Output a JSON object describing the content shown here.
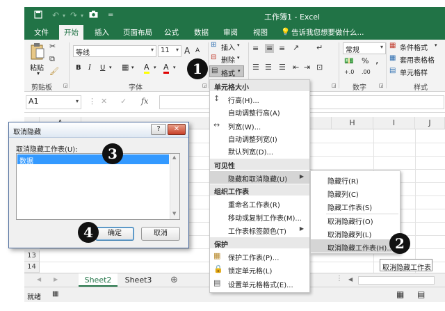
{
  "app": {
    "title": "工作簿1 - Excel",
    "qa_save_icon": "save-icon",
    "qa_undo_icon": "undo-icon",
    "qa_redo_icon": "redo-icon",
    "qa_camera_icon": "camera-icon",
    "qa_customize": "="
  },
  "tabs": {
    "file": "文件",
    "home": "开始",
    "insert": "插入",
    "layout": "页面布局",
    "formulas": "公式",
    "data": "数据",
    "review": "审阅",
    "view": "视图",
    "tell": "告诉我您想要做什么..."
  },
  "ribbon": {
    "paste": "粘贴",
    "clipboard": "剪贴板",
    "font_name": "等线",
    "font_size": "11",
    "grow": "A",
    "shrink": "A",
    "bold": "B",
    "italic": "I",
    "underline": "U",
    "font_color_glyph": "A",
    "highlight_glyph": "A",
    "font_group": "字体",
    "insert_btn": "插入",
    "delete_btn": "删除",
    "format_btn": "格式",
    "number_format": "常规",
    "percent": "%",
    "comma": ",",
    "dec_inc": "+.0",
    "dec_dec": ".00",
    "number_group": "数字",
    "cond_format": "条件格式",
    "table_format": "套用表格格",
    "cell_style": "单元格样",
    "style_group": "样式",
    "accent": "#217346"
  },
  "formula_bar": {
    "name_box": "A1",
    "cancel": "✕",
    "enter": "✓",
    "fx": "fx"
  },
  "grid": {
    "col_a": "A",
    "col_h": "H",
    "col_i": "I",
    "col_j": "J",
    "row_13": "13",
    "row_14": "14"
  },
  "sheets": {
    "sheet2": "Sheet2",
    "sheet3": "Sheet3",
    "add": "⊕",
    "prev": "◀",
    "next": "▶"
  },
  "status": {
    "ready": "就绪"
  },
  "menu": {
    "sec_size": "单元格大小",
    "row_height": "行高(H)...",
    "auto_row": "自动调整行高(A)",
    "col_width": "列宽(W)...",
    "auto_col": "自动调整列宽(I)",
    "default_width": "默认列宽(D)...",
    "sec_visibility": "可见性",
    "hide_unhide": "隐藏和取消隐藏(U)",
    "sec_organize": "组织工作表",
    "rename": "重命名工作表(R)",
    "move_copy": "移动或复制工作表(M)...",
    "tab_color": "工作表标签颜色(T)",
    "sec_protect": "保护",
    "protect_sheet": "保护工作表(P)...",
    "lock_cell": "锁定单元格(L)",
    "format_cells": "设置单元格格式(E)..."
  },
  "submenu": {
    "hide_row": "隐藏行(R)",
    "hide_col": "隐藏列(C)",
    "hide_sheet": "隐藏工作表(S)",
    "unhide_row": "取消隐藏行(O)",
    "unhide_col": "取消隐藏列(L)",
    "unhide_sheet": "取消隐藏工作表(H)..."
  },
  "tooltip": "取消隐藏工作表",
  "dialog": {
    "title": "取消隐藏",
    "help": "?",
    "close": "✕",
    "label": "取消隐藏工作表(U):",
    "items": [
      "数据"
    ],
    "ok": "确定",
    "cancel": "取消"
  },
  "badges": {
    "b1": "1",
    "b2": "2",
    "b3": "3",
    "b4": "4"
  }
}
